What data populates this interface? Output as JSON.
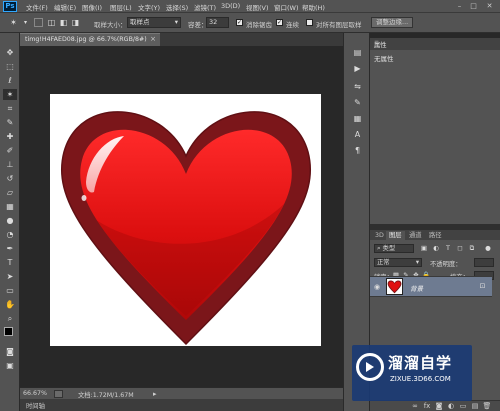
{
  "menubar": {
    "logo": "Ps",
    "items": [
      "文件(F)",
      "编辑(E)",
      "图像(I)",
      "图层(L)",
      "文字(Y)",
      "选择(S)",
      "滤镜(T)",
      "3D(D)",
      "视图(V)",
      "窗口(W)",
      "帮助(H)"
    ],
    "window_controls": [
      "–",
      "□",
      "✕"
    ]
  },
  "options": {
    "tool_icon": "magic-wand-icon",
    "sample_size_label": "取样大小：",
    "sample_size_value": "取样点",
    "tolerance_label": "容差：",
    "tolerance_value": "32",
    "antialias_label": "消除锯齿",
    "antialias_checked": true,
    "contiguous_label": "连续",
    "contiguous_checked": true,
    "all_layers_label": "对所有图层取样",
    "all_layers_checked": false,
    "refine_edge_label": "调整边缘..."
  },
  "document": {
    "tab_title": "timg!H4FAED08.jpg @ 66.7%(RGB/8#)",
    "close": "×"
  },
  "status": {
    "zoom": "66.67%",
    "doc_info": "文档:1.72M/1.67M",
    "bottom_tab": "时间轴"
  },
  "properties_panel": {
    "title": "属性",
    "empty_text": "无属性"
  },
  "layers_panel": {
    "tabs": [
      "3D",
      "图层",
      "通道",
      "路径"
    ],
    "active_tab": "图层",
    "filter_label": "类型",
    "blend_mode": "正常",
    "opacity_label": "不透明度：",
    "lock_label": "锁定：",
    "fill_label": "填充：",
    "layer_name": "背景"
  },
  "watermark": {
    "title": "溜溜自学",
    "url": "ZIXUE.3D66.COM"
  },
  "colors": {
    "chrome": "#535353",
    "workspace": "#282828",
    "heart_outer": "#7b161a",
    "heart_inner": "#e01010",
    "selected_layer": "#6e7b91",
    "watermark_bg": "#1a3a74"
  }
}
